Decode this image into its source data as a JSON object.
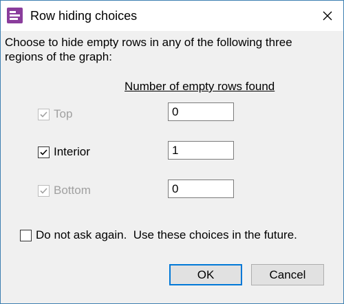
{
  "window": {
    "title": "Row hiding choices"
  },
  "description": "Choose to hide empty rows in any of the following three regions of the graph:",
  "column_header": "Number of empty rows found",
  "regions": [
    {
      "label": "Top",
      "checked": true,
      "enabled": false,
      "count": "0"
    },
    {
      "label": "Interior",
      "checked": true,
      "enabled": true,
      "count": "1"
    },
    {
      "label": "Bottom",
      "checked": true,
      "enabled": false,
      "count": "0"
    }
  ],
  "do_not_ask": {
    "label": "Do not ask again.  Use these choices in the future.",
    "checked": false
  },
  "buttons": {
    "ok": "OK",
    "cancel": "Cancel"
  },
  "icons": {
    "app": "app-icon",
    "close": "close-icon",
    "check": "checkmark-icon"
  },
  "colors": {
    "accent": "#0078d7",
    "app_icon": "#8a3d9c",
    "disabled_text": "#a0a0a0"
  }
}
